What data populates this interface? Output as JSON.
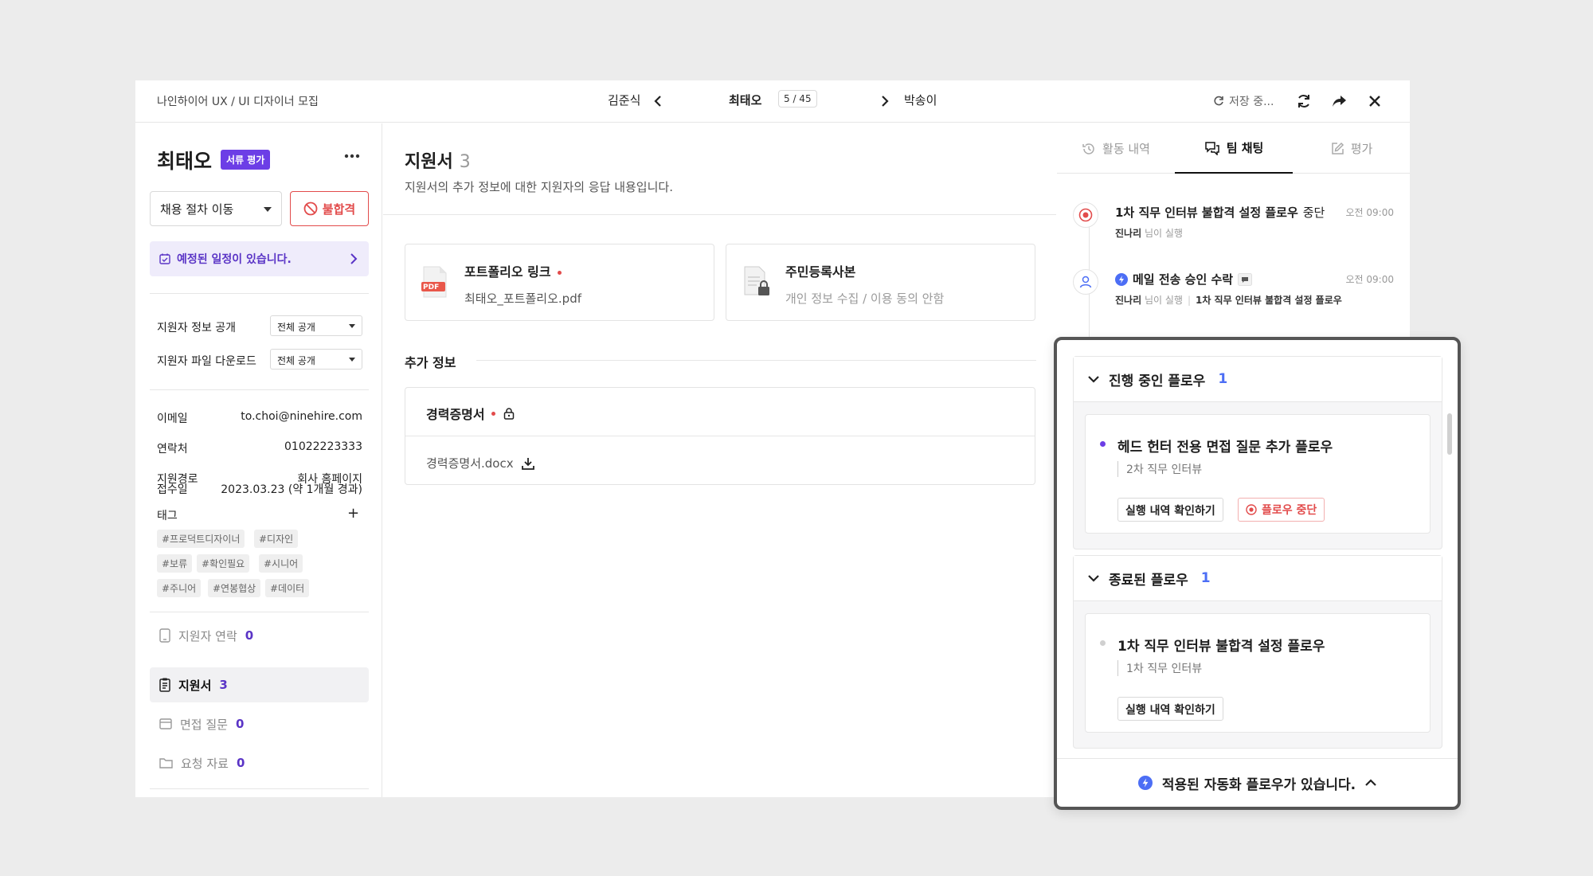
{
  "topbar": {
    "job_title": "나인하이어 UX / UI 디자이너 모집",
    "prev_candidate": "김준식",
    "current_candidate": "최태오",
    "position": "5 / 45",
    "next_candidate": "박송이",
    "save_status": "저장 중..."
  },
  "candidate": {
    "name": "최태오",
    "stage_badge": "서류 평가",
    "move_stage_label": "채용 절차 이동",
    "reject_label": "불합격",
    "schedule_notice": "예정된 일정이 있습니다."
  },
  "settings": [
    {
      "label": "지원자 정보 공개",
      "value": "전체 공개"
    },
    {
      "label": "지원자 파일 다운로드",
      "value": "전체 공개"
    }
  ],
  "info": [
    {
      "key": "이메일",
      "value": "to.choi@ninehire.com"
    },
    {
      "key": "연락처",
      "value": "01022223333"
    },
    {
      "key": "지원경로",
      "value": "회사 홈페이지"
    },
    {
      "key": "접수일",
      "value": "2023.03.23 (약 1개월 경과)"
    }
  ],
  "tags_label": "태그",
  "tags": [
    "#프로덕트디자이너",
    "#디자인",
    "#보류",
    "#확인필요",
    "#시니어",
    "#주니어",
    "#연봉협상",
    "#데이터"
  ],
  "nav": [
    {
      "label": "지원자 연락",
      "count": "0"
    },
    {
      "label": "지원서",
      "count": "3"
    },
    {
      "label": "면접 질문",
      "count": "0"
    },
    {
      "label": "요청 자료",
      "count": "0"
    }
  ],
  "main": {
    "title": "지원서",
    "count": "3",
    "description": "지원서의 추가 정보에 대한 지원자의 응답 내용입니다.",
    "files": [
      {
        "title": "포트폴리오 링크",
        "subtitle": "최태오_포트폴리오.pdf",
        "pdf_label": "PDF"
      },
      {
        "title": "주민등록사본",
        "subtitle": "개인 정보 수집 / 이용 동의 안함"
      }
    ],
    "extra_label": "추가 정보",
    "extra_doc": {
      "title": "경력증명서",
      "file": "경력증명서.docx"
    }
  },
  "tabs": [
    {
      "label": "활동 내역"
    },
    {
      "label": "팀 채팅"
    },
    {
      "label": "평가"
    }
  ],
  "activity": [
    {
      "title": "1차 직무 인터뷰 불합격 설정 플로우",
      "status": "중단",
      "time": "오전 09:00",
      "by": "진나리",
      "by_suffix": "님이 실행"
    },
    {
      "title": "메일 전송 승인 수락",
      "time": "오전 09:00",
      "by": "진나리",
      "by_suffix": "님이 실행",
      "flow": "1차 직무 인터뷰 불합격 설정 플로우"
    }
  ],
  "flows": {
    "running": {
      "label": "진행 중인 플로우",
      "count": "1",
      "item": {
        "title": "헤드 헌터 전용 면접 질문 추가 플로우",
        "stage": "2차 직무 인터뷰",
        "view_label": "실행 내역 확인하기",
        "stop_label": "플로우 중단"
      }
    },
    "ended": {
      "label": "종료된 플로우",
      "count": "1",
      "item": {
        "title": "1차 직무 인터뷰 불합격 설정 플로우",
        "stage": "1차 직무 인터뷰",
        "view_label": "실행 내역 확인하기"
      }
    },
    "footer": "적용된 자동화 플로우가 있습니다."
  },
  "colors": {
    "accent": "#6c3ee6",
    "danger": "#e24b4b",
    "link_blue": "#4c6ef5"
  }
}
